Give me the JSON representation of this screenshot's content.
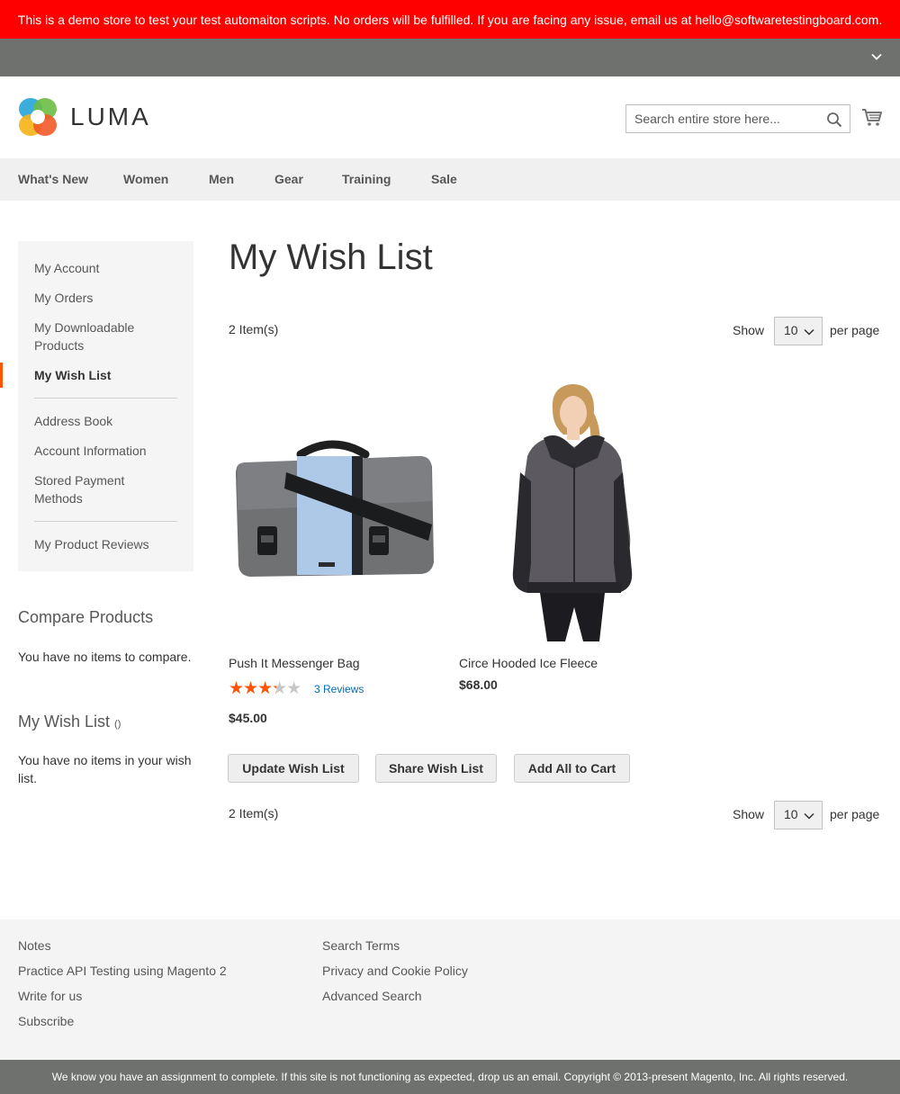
{
  "demo_notice": "This is a demo store to test your test automaiton scripts. No orders will be fulfilled. If you are facing any issue, email us at hello@softwaretestingboard.com.",
  "header": {
    "logo_text": "LUMA",
    "search_placeholder": "Search entire store here...",
    "search_icon": "search-icon",
    "cart_icon": "cart-icon"
  },
  "nav": {
    "items": [
      "What's New",
      "Women",
      "Men",
      "Gear",
      "Training",
      "Sale"
    ]
  },
  "sidebar": {
    "account_links": [
      "My Account",
      "My Orders",
      "My Downloadable Products",
      "My Wish List",
      "Address Book",
      "Account Information",
      "Stored Payment Methods",
      "My Product Reviews"
    ],
    "current": "My Wish List",
    "compare": {
      "title": "Compare Products",
      "empty_text": "You have no items to compare."
    },
    "wishlist_block": {
      "title": "My Wish List",
      "count": "()",
      "empty_text": "You have no items in your wish list."
    }
  },
  "main": {
    "title": "My Wish List",
    "toolbar": {
      "count_text": "2 Item(s)",
      "show_label": "Show",
      "limit_value": "10",
      "per_page_label": "per page"
    },
    "products": [
      {
        "name": "Push It Messenger Bag",
        "price": "$45.00",
        "rating_percent": 60,
        "reviews_text": "3 Reviews"
      },
      {
        "name": "Circe Hooded Ice Fleece",
        "price": "$68.00"
      }
    ],
    "buttons": {
      "update": "Update Wish List",
      "share": "Share Wish List",
      "add_all": "Add All to Cart"
    }
  },
  "footer": {
    "col1": [
      "Notes",
      "Practice API Testing using Magento 2",
      "Write for us",
      "Subscribe"
    ],
    "col2": [
      "Search Terms",
      "Privacy and Cookie Policy",
      "Advanced Search"
    ],
    "copyright": "We know you have an assignment to complete. If this site is not functioning as expected, drop us an email. Copyright © 2013-present Magento, Inc. All rights reserved."
  },
  "colors": {
    "banner_red": "#ff0000",
    "panel_gray": "#6e716e",
    "nav_bg": "#f0f0f0",
    "active_orange": "#ff5501",
    "link_blue": "#006bb4"
  }
}
